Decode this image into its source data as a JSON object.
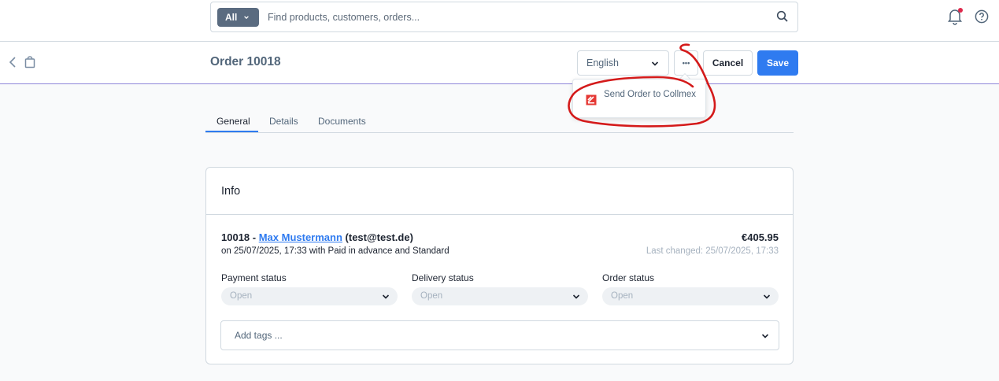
{
  "search": {
    "type_label": "All",
    "placeholder": "Find products, customers, orders..."
  },
  "header": {
    "page_title": "Order 10018",
    "language": "English",
    "more_label": "•••",
    "cancel_label": "Cancel",
    "save_label": "Save"
  },
  "dropdown": {
    "items": [
      {
        "label": "Send Order to Collmex",
        "icon": "collmex-logo-icon"
      }
    ]
  },
  "tabs": [
    {
      "label": "General",
      "active": true
    },
    {
      "label": "Details",
      "active": false
    },
    {
      "label": "Documents",
      "active": false
    }
  ],
  "info": {
    "title": "Info",
    "order_number": "10018 -",
    "customer_name": "Max Mustermann",
    "customer_email": "(test@test.de)",
    "order_subline": "on 25/07/2025, 17:33 with Paid in advance and Standard",
    "amount": "€405.95",
    "last_changed": "Last changed: 25/07/2025, 17:33",
    "payment_status_label": "Payment status",
    "payment_status_value": "Open",
    "delivery_status_label": "Delivery status",
    "delivery_status_value": "Open",
    "order_status_label": "Order status",
    "order_status_value": "Open",
    "tags_placeholder": "Add tags ..."
  },
  "colors": {
    "primary": "#2f7bf0",
    "annotation": "#d41a1a",
    "notification_dot": "#de294c"
  }
}
